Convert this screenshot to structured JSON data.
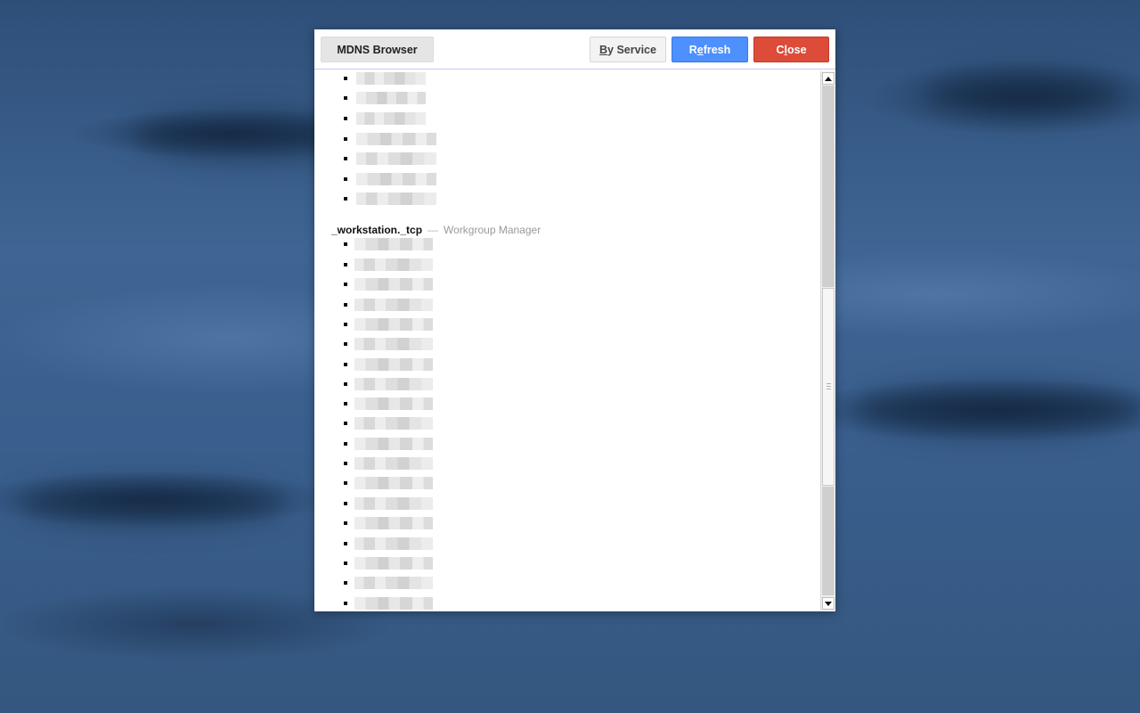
{
  "window": {
    "title_button": "MDNS Browser",
    "by_service_label": "By Service",
    "by_service_mnemonic": "B",
    "refresh_label": "Refresh",
    "refresh_mnemonic": "e",
    "close_label": "Close",
    "close_mnemonic": "l"
  },
  "colors": {
    "refresh_button": "#4d90fe",
    "close_button": "#dd4b39",
    "toolbar_border": "#c5c9f2"
  },
  "services": [
    {
      "name": "_workstation._tcp",
      "separator": "—",
      "description": "Workgroup Manager"
    }
  ],
  "list_items_note_redacted": true
}
